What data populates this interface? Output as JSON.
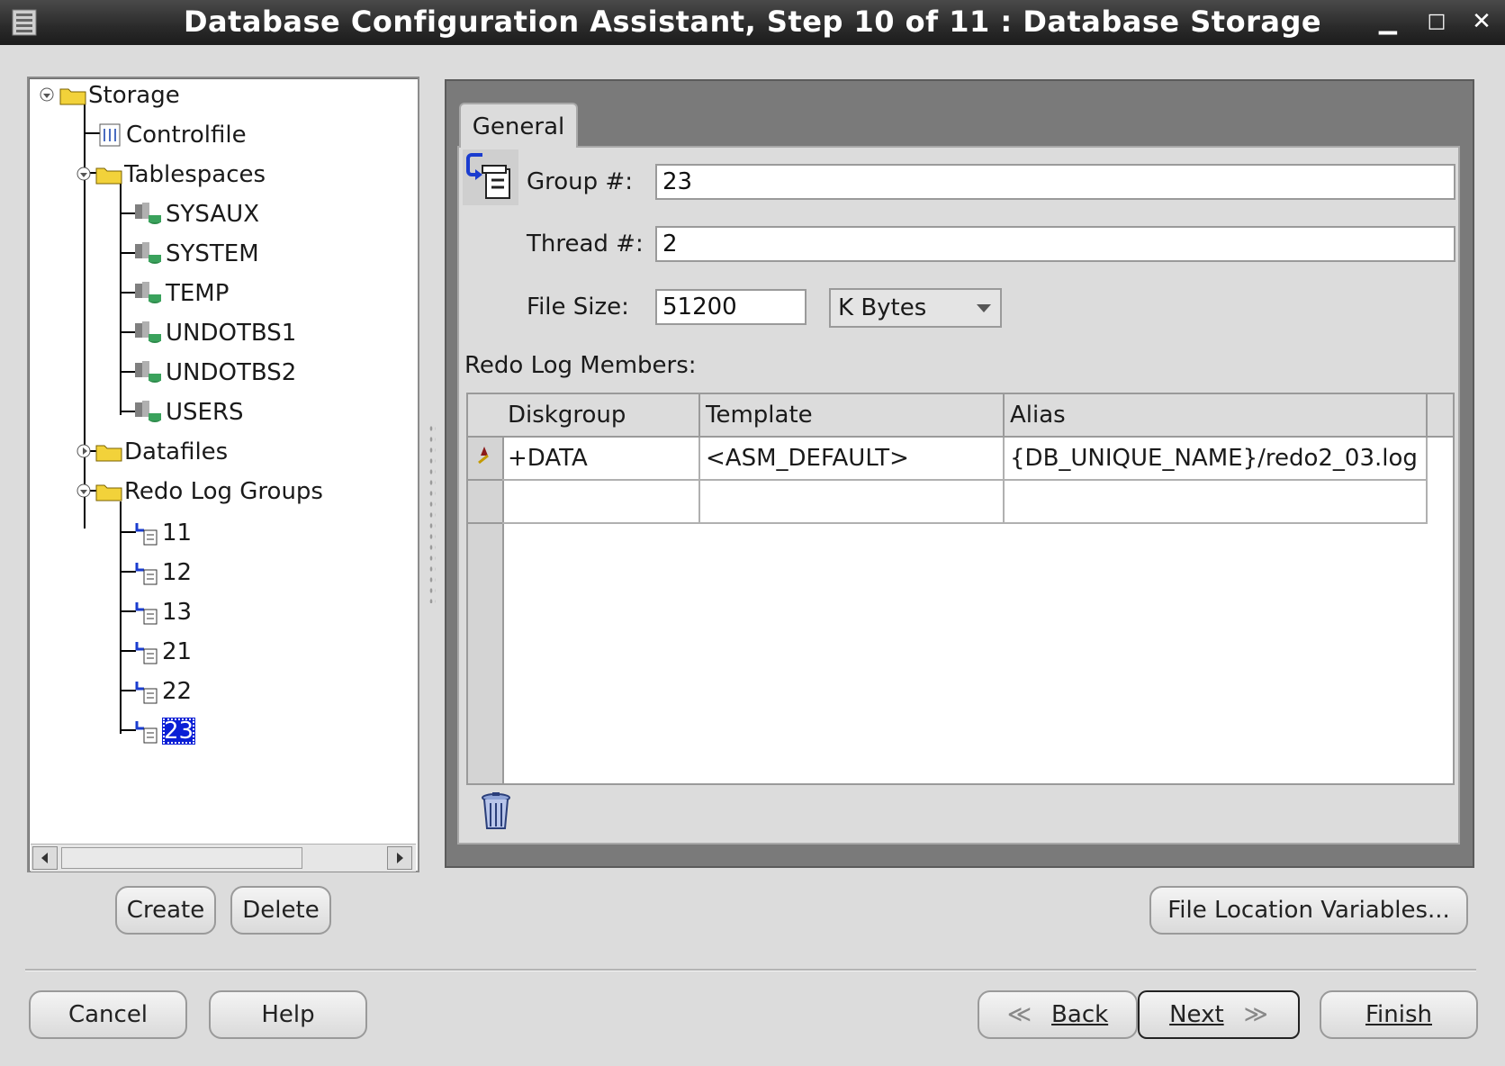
{
  "window": {
    "title": "Database Configuration Assistant, Step 10 of 11 : Database Storage",
    "minimize_icon": "minimize-icon",
    "maximize_icon": "maximize-icon",
    "close_icon": "close-icon"
  },
  "tree": {
    "root": "Storage",
    "controlfile": "Controlfile",
    "tablespaces": {
      "label": "Tablespaces",
      "items": [
        "SYSAUX",
        "SYSTEM",
        "TEMP",
        "UNDOTBS1",
        "UNDOTBS2",
        "USERS"
      ]
    },
    "datafiles": "Datafiles",
    "redo_log_groups": {
      "label": "Redo Log Groups",
      "items": [
        "11",
        "12",
        "13",
        "21",
        "22",
        "23"
      ],
      "selected": "23"
    }
  },
  "tree_buttons": {
    "create": "Create",
    "delete": "Delete"
  },
  "tabs": {
    "general": "General"
  },
  "form": {
    "group_label": "Group #:",
    "group_value": "23",
    "thread_label": "Thread #:",
    "thread_value": "2",
    "filesize_label": "File Size:",
    "filesize_value": "51200",
    "units_value": "K Bytes",
    "members_label": "Redo Log Members:"
  },
  "table": {
    "headers": [
      "Diskgroup",
      "Template",
      "Alias"
    ],
    "rows": [
      [
        "+DATA",
        "<ASM_DEFAULT>",
        "{DB_UNIQUE_NAME}/redo2_03.log"
      ],
      [
        "",
        "",
        ""
      ]
    ]
  },
  "buttons": {
    "file_location_variables": "File Location Variables...",
    "cancel": "Cancel",
    "help": "Help",
    "back": "Back",
    "next": "Next",
    "finish": "Finish"
  }
}
